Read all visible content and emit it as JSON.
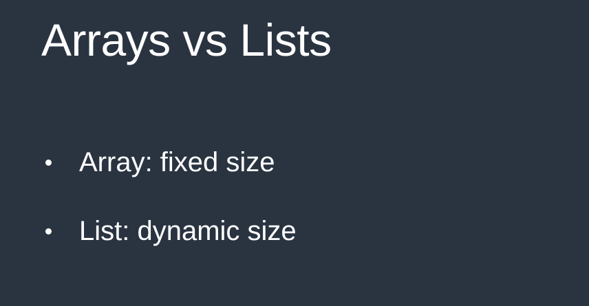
{
  "slide": {
    "title": "Arrays vs Lists",
    "bullets": [
      "Array: fixed size",
      "List: dynamic size"
    ]
  }
}
